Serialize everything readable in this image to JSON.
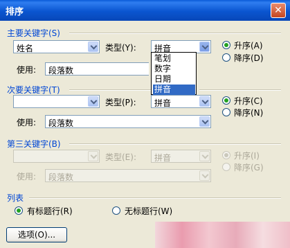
{
  "dialog": {
    "title": "排序",
    "close_glyph": "✕"
  },
  "primary": {
    "group_label": "主要关键字(S)",
    "keyword_value": "姓名",
    "type_label": "类型(Y):",
    "type_value": "拼音",
    "use_label": "使用:",
    "use_value": "段落数",
    "asc_label": "升序(A)",
    "desc_label": "降序(D)",
    "dropdown_options": [
      "笔划",
      "数字",
      "日期",
      "拼音"
    ],
    "dropdown_selected": "拼音"
  },
  "secondary": {
    "group_label": "次要关键字(T)",
    "keyword_value": "",
    "type_label": "类型(P):",
    "type_value": "拼音",
    "use_label": "使用:",
    "use_value": "段落数",
    "asc_label": "升序(C)",
    "desc_label": "降序(N)"
  },
  "tertiary": {
    "group_label": "第三关键字(B)",
    "keyword_value": "",
    "type_label": "类型(E):",
    "type_value": "拼音",
    "use_label": "使用:",
    "use_value": "段落数",
    "asc_label": "升序(I)",
    "desc_label": "降序(G)"
  },
  "list": {
    "group_label": "列表",
    "with_header_label": "有标题行(R)",
    "no_header_label": "无标题行(W)"
  },
  "buttons": {
    "options_label": "选项(O)..."
  },
  "colors": {
    "title_bar": "#0a5bd8",
    "group_label": "#0046d5",
    "selection": "#316ac5",
    "radio_dot": "#21a121"
  }
}
